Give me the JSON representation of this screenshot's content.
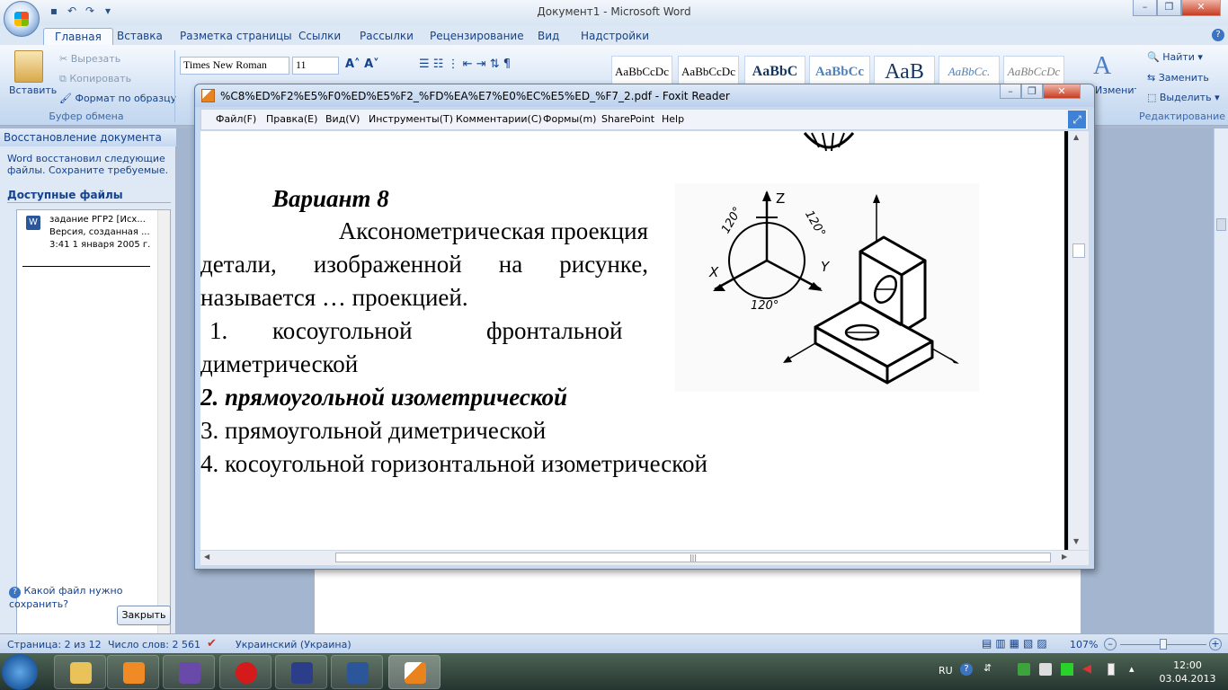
{
  "word": {
    "title": "Документ1 - Microsoft Word",
    "tabs": [
      "Главная",
      "Вставка",
      "Разметка страницы",
      "Ссылки",
      "Рассылки",
      "Рецензирование",
      "Вид",
      "Надстройки"
    ],
    "clipboard": {
      "paste": "Вставить",
      "cut": "Вырезать",
      "copy": "Копировать",
      "format_painter": "Формат по образцу",
      "group": "Буфер обмена"
    },
    "font": {
      "name": "Times New Roman",
      "size": "11"
    },
    "styles": [
      "AaBbCcDc",
      "AaBbCcDc",
      "AaBbC",
      "AaBbCc",
      "АаВ",
      "AaBbCc.",
      "AaBbCcDc"
    ],
    "change_styles": "Изменить стили",
    "editing": {
      "find": "Найти",
      "replace": "Заменить",
      "select": "Выделить",
      "group": "Редактирование"
    }
  },
  "recovery": {
    "header": "Восстановление документа",
    "message": "Word восстановил следующие файлы.  Сохраните требуемые.",
    "available": "Доступные файлы",
    "file": {
      "line1": "задание РГР2  [Исх...",
      "line2": "Версия, созданная ...",
      "line3": "3:41 1 января 2005 г."
    },
    "help": "Какой файл нужно сохранить?",
    "close": "Закрыть"
  },
  "status": {
    "page": "Страница: 2 из 12",
    "words": "Число слов: 2 561",
    "lang": "Украинский (Украина)",
    "zoom": "107%"
  },
  "foxit": {
    "title": "%C8%ED%F2%E5%F0%ED%E5%F2_%FD%EA%E7%E0%EC%E5%ED_%F7_2.pdf - Foxit Reader",
    "menu": [
      "Файл(F)",
      "Правка(E)",
      "Вид(V)",
      "Инструменты(T)",
      "Комментарии(C)",
      "Формы(m)",
      "SharePoint",
      "Help"
    ]
  },
  "pdf": {
    "variant": "Вариант 8",
    "q1": "Аксонометрическая  проекция",
    "q2": "детали,  изображенной  на  рисунке,",
    "q3": "называется … проекцией.",
    "a1a": "1.",
    "a1b": "косоугольной",
    "a1c": "фронтальной",
    "a1d": "диметрической",
    "a2": "2. прямоугольной изометрической",
    "a3": "3. прямоугольной диметрической",
    "a4": "4. косоугольной  горизонтальной изометрической",
    "fig": {
      "z": "Z",
      "x": "X",
      "y": "Y",
      "angle": "120°"
    }
  },
  "taskbar": {
    "lang": "RU",
    "time": "12:00",
    "date": "03.04.2013"
  }
}
